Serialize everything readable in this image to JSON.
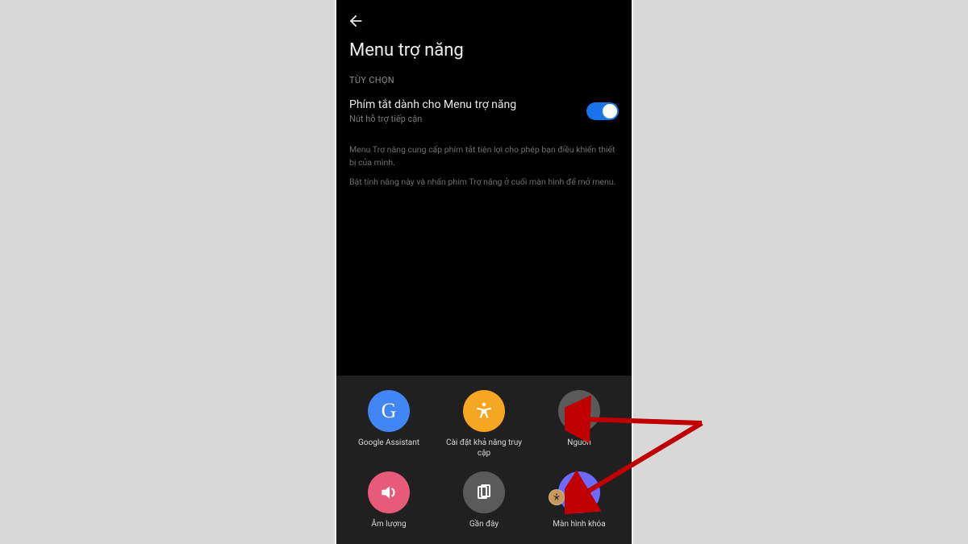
{
  "header": {
    "title": "Menu trợ năng"
  },
  "section_label": "TÙY CHỌN",
  "setting": {
    "title": "Phím tắt dành cho Menu trợ năng",
    "subtitle": "Nút hỗ trợ tiếp cận",
    "enabled": true
  },
  "description1": "Menu Trợ năng cung cấp phím tắt tiện lợi cho phép bạn điều khiển thiết bị của mình.",
  "description2": "Bật tính năng này và nhấn phím Trợ năng ở cuối màn hình để mở menu.",
  "menu": {
    "items": [
      {
        "id": "google-assistant",
        "label": "Google Assistant",
        "icon": "letter-g",
        "color": "c-blue"
      },
      {
        "id": "accessibility-settings",
        "label": "Cài đặt khả năng truy cập",
        "icon": "accessibility",
        "color": "c-orange"
      },
      {
        "id": "power",
        "label": "Nguồn",
        "icon": "power",
        "color": "c-grey"
      },
      {
        "id": "volume",
        "label": "Âm lượng",
        "icon": "volume",
        "color": "c-pink"
      },
      {
        "id": "recent",
        "label": "Gần đây",
        "icon": "recent",
        "color": "c-grey2"
      },
      {
        "id": "lock-screen",
        "label": "Màn hình khóa",
        "icon": "lock",
        "color": "c-purple"
      }
    ]
  },
  "fab": {
    "icon": "accessibility"
  }
}
